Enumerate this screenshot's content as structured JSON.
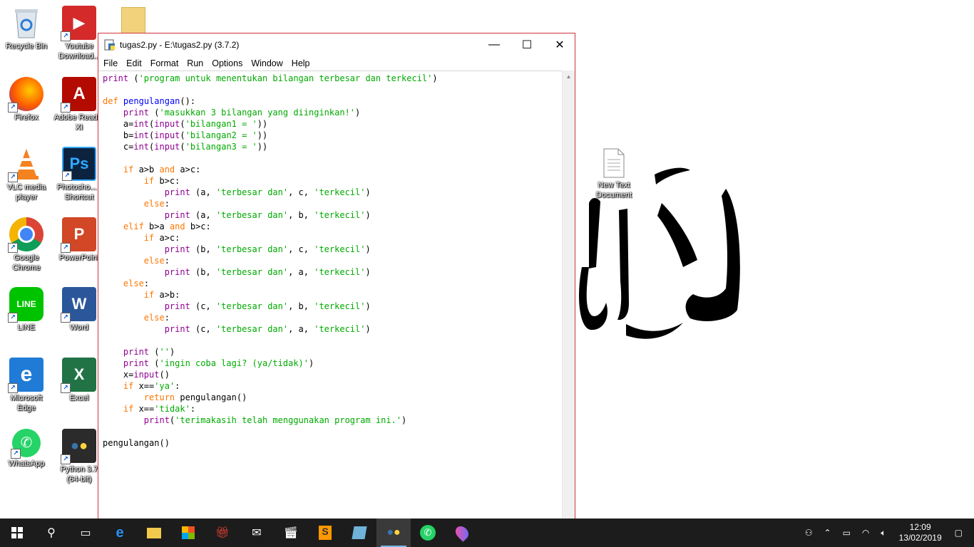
{
  "desktop": {
    "icons": [
      {
        "label": "Recycle Bin"
      },
      {
        "label": "Youtube Download..."
      },
      {
        "label": "Firefox"
      },
      {
        "label": "Adobe Reader XI"
      },
      {
        "label": "VLC media player"
      },
      {
        "label": "Photosho... - Shortcut"
      },
      {
        "label": "Google Chrome"
      },
      {
        "label": "PowerPoint"
      },
      {
        "label": "LINE"
      },
      {
        "label": "Word"
      },
      {
        "label": "Microsoft Edge"
      },
      {
        "label": "Excel"
      },
      {
        "label": "WhatsApp"
      },
      {
        "label": "Python 3.7 (64-bit)"
      },
      {
        "label": "New Text Document"
      }
    ]
  },
  "window": {
    "title": "tugas2.py - E:\\tugas2.py (3.7.2)",
    "minimize_label": "—",
    "maximize_label": "☐",
    "close_label": "✕",
    "menu": [
      "File",
      "Edit",
      "Format",
      "Run",
      "Options",
      "Window",
      "Help"
    ]
  },
  "code": {
    "lines": [
      "print ('program untuk menentukan bilangan terbesar dan terkecil')",
      "",
      "def pengulangan():",
      "    print ('masukkan 3 bilangan yang diinginkan!')",
      "    a=int(input('bilangan1 = '))",
      "    b=int(input('bilangan2 = '))",
      "    c=int(input('bilangan3 = '))",
      "",
      "    if a>b and a>c:",
      "        if b>c:",
      "            print (a, 'terbesar dan', c, 'terkecil')",
      "        else:",
      "            print (a, 'terbesar dan', b, 'terkecil')",
      "    elif b>a and b>c:",
      "        if a>c:",
      "            print (b, 'terbesar dan', c, 'terkecil')",
      "        else:",
      "            print (b, 'terbesar dan', a, 'terkecil')",
      "    else:",
      "        if a>b:",
      "            print (c, 'terbesar dan', b, 'terkecil')",
      "        else:",
      "            print (c, 'terbesar dan', a, 'terkecil')",
      "",
      "    print ('')",
      "    print ('ingin coba lagi? (ya/tidak)')",
      "    x=input()",
      "    if x=='ya':",
      "        return pengulangan()",
      "    if x=='tidak':",
      "        print('terimakasih telah menggunakan program ini.')",
      "",
      "pengulangan()"
    ]
  },
  "taskbar": {
    "time": "12:09",
    "date": "13/02/2019"
  },
  "colors": {
    "keyword": "#ff7700",
    "builtin": "#900090",
    "string": "#00aa00",
    "defname": "#0000ff",
    "window_border": "#d0343b",
    "taskbar": "#1c1c1c"
  }
}
